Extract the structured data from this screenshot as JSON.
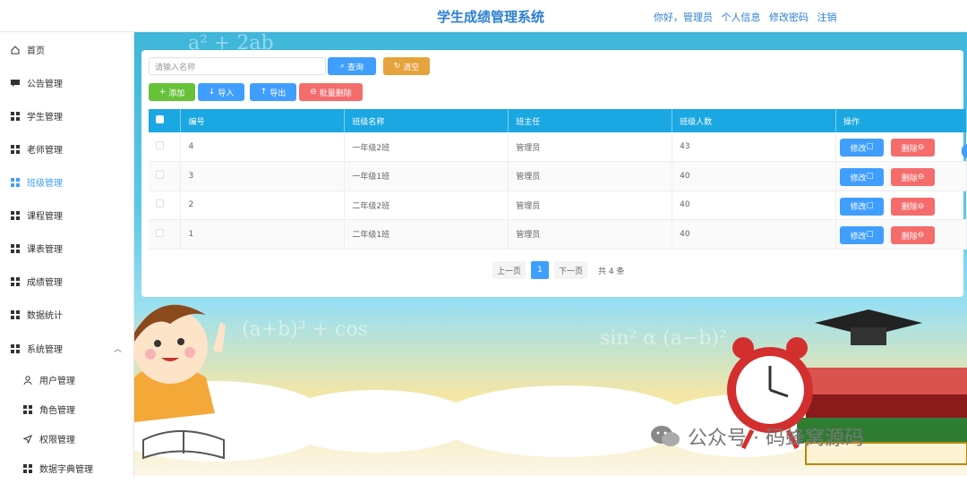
{
  "app": {
    "title": "学生成绩管理系统"
  },
  "header": {
    "greeting": "你好，管理员",
    "profile": "个人信息",
    "change_password": "修改密码",
    "logout": "注销"
  },
  "sidebar": {
    "items": [
      {
        "label": "首页",
        "icon": "home-icon"
      },
      {
        "label": "公告管理",
        "icon": "comment-icon"
      },
      {
        "label": "学生管理",
        "icon": "grid-icon"
      },
      {
        "label": "老师管理",
        "icon": "grid-icon"
      },
      {
        "label": "班级管理",
        "icon": "grid-icon",
        "active": true
      },
      {
        "label": "课程管理",
        "icon": "grid-icon"
      },
      {
        "label": "课表管理",
        "icon": "grid-icon"
      },
      {
        "label": "成绩管理",
        "icon": "grid-icon"
      },
      {
        "label": "数据统计",
        "icon": "grid-icon"
      },
      {
        "label": "系统管理",
        "icon": "apps-icon",
        "expanded": true
      }
    ],
    "sub_items": [
      {
        "label": "用户管理",
        "icon": "user-icon"
      },
      {
        "label": "角色管理",
        "icon": "grid-icon"
      },
      {
        "label": "权限管理",
        "icon": "send-icon"
      },
      {
        "label": "数据字典管理",
        "icon": "grid-icon"
      }
    ]
  },
  "toolbar": {
    "search_placeholder": "请输入名称",
    "query": "查询",
    "reset": "清空",
    "add": "添加",
    "import": "导入",
    "export": "导出",
    "batch_delete": "批量删除"
  },
  "table": {
    "columns": [
      "编号",
      "班级名称",
      "班主任",
      "班级人数",
      "操作"
    ],
    "rows": [
      [
        "4",
        "一年级2班",
        "管理员",
        "43"
      ],
      [
        "3",
        "一年级1班",
        "管理员",
        "40"
      ],
      [
        "2",
        "二年级2班",
        "管理员",
        "40"
      ],
      [
        "1",
        "二年级1班",
        "管理员",
        "40"
      ]
    ],
    "edit_label": "修改",
    "delete_label": "删除"
  },
  "pagination": {
    "prev": "上一页",
    "current": "1",
    "next": "下一页",
    "total": "共 4 条"
  },
  "watermark": "公众号 · 码蜂窝源码",
  "colors": {
    "primary": "#409eff",
    "header_blue": "#1ba7e1",
    "danger": "#f56c6c",
    "warning": "#e6a23c",
    "success": "#67c23a"
  }
}
